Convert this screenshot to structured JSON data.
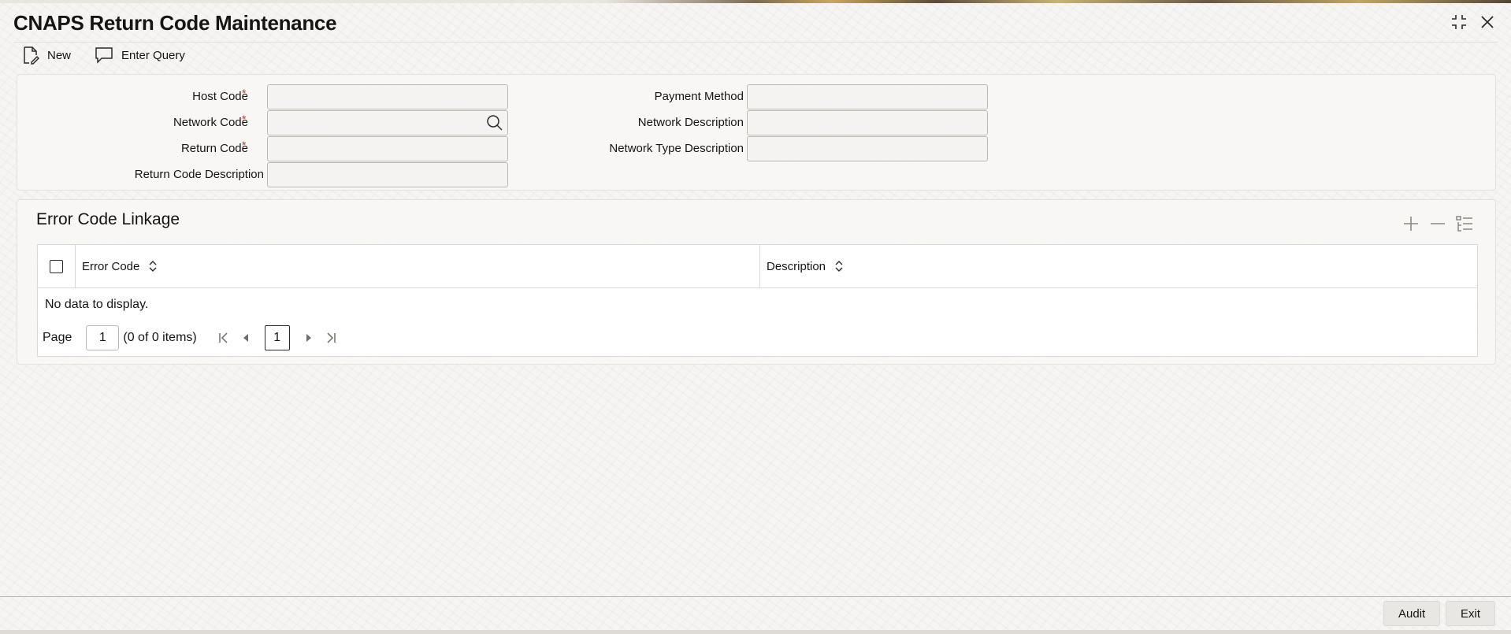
{
  "window": {
    "title": "CNAPS Return Code Maintenance"
  },
  "toolbar": {
    "new_label": "New",
    "enter_query_label": "Enter Query"
  },
  "form": {
    "host_code": {
      "label": "Host Code",
      "required": true,
      "value": ""
    },
    "network_code": {
      "label": "Network Code",
      "required": true,
      "value": ""
    },
    "return_code": {
      "label": "Return Code",
      "required": true,
      "value": ""
    },
    "return_code_description": {
      "label": "Return Code Description",
      "required": false,
      "value": ""
    },
    "payment_method": {
      "label": "Payment Method",
      "value": ""
    },
    "network_description": {
      "label": "Network Description",
      "value": ""
    },
    "network_type_description": {
      "label": "Network Type Description",
      "value": ""
    },
    "required_marker": "*"
  },
  "grid": {
    "title": "Error Code Linkage",
    "columns": [
      "Error Code",
      "Description"
    ],
    "rows": [],
    "empty_text": "No data to display.",
    "pagination": {
      "page_label": "Page",
      "page_input": "1",
      "count_text": "(0 of 0 items)",
      "current_page": "1"
    }
  },
  "footer": {
    "audit_label": "Audit",
    "exit_label": "Exit"
  },
  "colors": {
    "required": "#c0392b",
    "text": "#161513"
  }
}
